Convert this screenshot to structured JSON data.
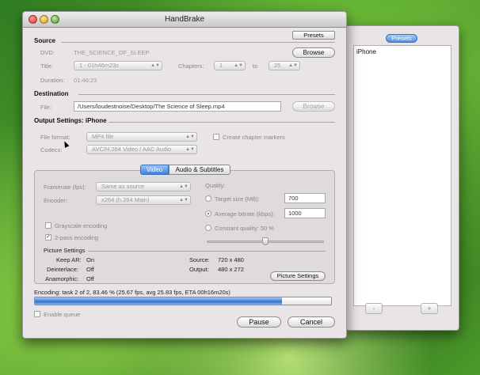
{
  "window": {
    "title": "HandBrake",
    "presets_button": "Presets"
  },
  "source": {
    "header": "Source",
    "dvd_label": "DVD:",
    "dvd_value": "THE_SCIENCE_OF_SLEEP",
    "browse": "Browse",
    "title_label": "Title:",
    "title_value": "1 - 01h46m23s",
    "chapters_label": "Chapters:",
    "chapter_start": "1",
    "to_label": "to",
    "chapter_end": "25",
    "duration_label": "Duration:",
    "duration_value": "01:46:23"
  },
  "destination": {
    "header": "Destination",
    "file_label": "File:",
    "file_value": "/Users/loudestnoise/Desktop/The Science of Sleep.mp4",
    "browse": "Browse"
  },
  "output": {
    "header": "Output Settings: iPhone",
    "format_label": "File format:",
    "format_value": "MP4 file",
    "chapter_markers": "Create chapter markers",
    "codecs_label": "Codecs:",
    "codecs_value": "AVC/H.264 Video / AAC Audio"
  },
  "tabs": [
    {
      "label": "Video"
    },
    {
      "label": "Audio & Subtitles"
    }
  ],
  "video": {
    "framerate_label": "Framerate (fps):",
    "framerate_value": "Same as source",
    "encoder_label": "Encoder:",
    "encoder_value": "x264 (h.264 Main)",
    "grayscale": "Grayscale encoding",
    "twopass": "2-pass encoding",
    "quality_label": "Quality:",
    "target_size_label": "Target size (MB):",
    "target_size_value": "700",
    "avg_bitrate_label": "Average bitrate (kbps):",
    "avg_bitrate_value": "1000",
    "constant_quality_label": "Constant quality: 50 %",
    "constant_quality_fraction": 0.5,
    "picture_header": "Picture Settings",
    "keep_ar_label": "Keep AR:",
    "keep_ar_value": "On",
    "deinterlace_label": "Deinterlace:",
    "deinterlace_value": "Off",
    "anamorphic_label": "Anamorphic:",
    "anamorphic_value": "Off",
    "source_label": "Source:",
    "source_value": "720 x 480",
    "output_label": "Output:",
    "output_value": "480 x 272",
    "picture_settings_button": "Picture Settings"
  },
  "encoding": {
    "status": "Encoding: task 2 of 2, 83.46 % (25.67 fps, avg 25.83 fps, ETA 00h16m20s)",
    "progress_percent": 83.46,
    "enable_queue": "Enable queue",
    "pause": "Pause",
    "cancel": "Cancel"
  },
  "presets_drawer": {
    "title": "Presets",
    "items": [
      {
        "label": "iPhone"
      }
    ],
    "remove": "-",
    "add": "+"
  }
}
